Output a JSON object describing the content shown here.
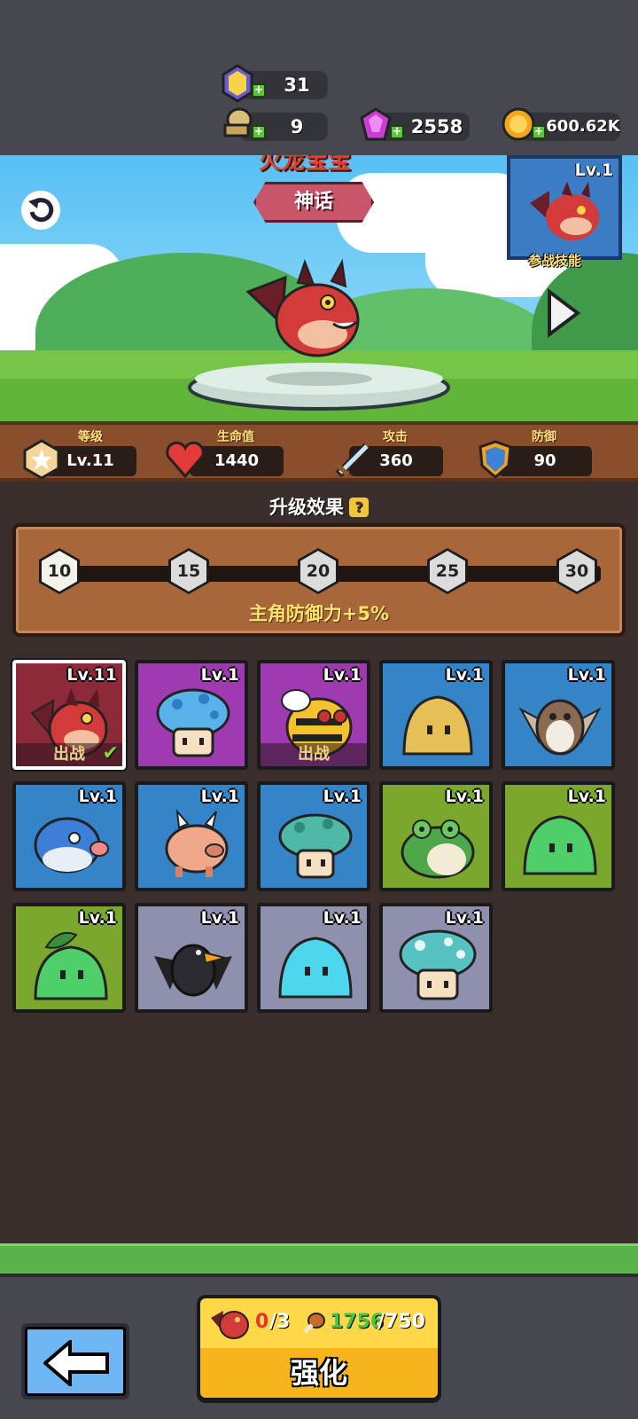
{
  "resources": {
    "gems": "31",
    "scroll": "9",
    "crystal": "2558",
    "gold": "600.62K"
  },
  "scene": {
    "pet_name_partial": "火龙宝宝",
    "rarity": "神话",
    "skill_card_level": "Lv.1",
    "skill_label": "参战技能"
  },
  "stats": {
    "level_label": "等级",
    "level_value": "Lv.11",
    "hp_label": "生命值",
    "hp_value": "1440",
    "atk_label": "攻击",
    "atk_value": "360",
    "def_label": "防御",
    "def_value": "90"
  },
  "upgrade": {
    "title": "升级效果",
    "help": "?",
    "milestones": [
      "10",
      "15",
      "20",
      "25",
      "30"
    ],
    "progress": 0.018,
    "effect": "主角防御力+5%"
  },
  "pets": [
    {
      "level": "Lv.11",
      "bg": "#8d2a3a",
      "icon": "red-dragon-icon",
      "deploy": "出战",
      "check": "✔"
    },
    {
      "level": "Lv.1",
      "bg": "#a03ab0",
      "icon": "blue-mushroom-icon"
    },
    {
      "level": "Lv.1",
      "bg": "#a03ab0",
      "icon": "bee-icon",
      "deploy": "出战"
    },
    {
      "level": "Lv.1",
      "bg": "#3584c8",
      "icon": "yellow-slime-icon"
    },
    {
      "level": "Lv.1",
      "bg": "#3584c8",
      "icon": "owl-icon"
    },
    {
      "level": "Lv.1",
      "bg": "#3584c8",
      "icon": "pufferfish-icon"
    },
    {
      "level": "Lv.1",
      "bg": "#3584c8",
      "icon": "pig-icon"
    },
    {
      "level": "Lv.1",
      "bg": "#3584c8",
      "icon": "teal-mushroom-icon"
    },
    {
      "level": "Lv.1",
      "bg": "#7aa82e",
      "icon": "frog-icon"
    },
    {
      "level": "Lv.1",
      "bg": "#7aa82e",
      "icon": "green-slime-icon"
    },
    {
      "level": "Lv.1",
      "bg": "#7aa82e",
      "icon": "leaf-slime-icon"
    },
    {
      "level": "Lv.1",
      "bg": "#8f8fae",
      "icon": "crow-icon"
    },
    {
      "level": "Lv.1",
      "bg": "#8f8fae",
      "icon": "cyan-slime-icon"
    },
    {
      "level": "Lv.1",
      "bg": "#8f8fae",
      "icon": "cyan-mushroom-icon"
    }
  ],
  "enhance": {
    "shard_have": "0",
    "shard_need": "/3",
    "food_have": "1756",
    "food_need": "/750",
    "label": "强化"
  }
}
